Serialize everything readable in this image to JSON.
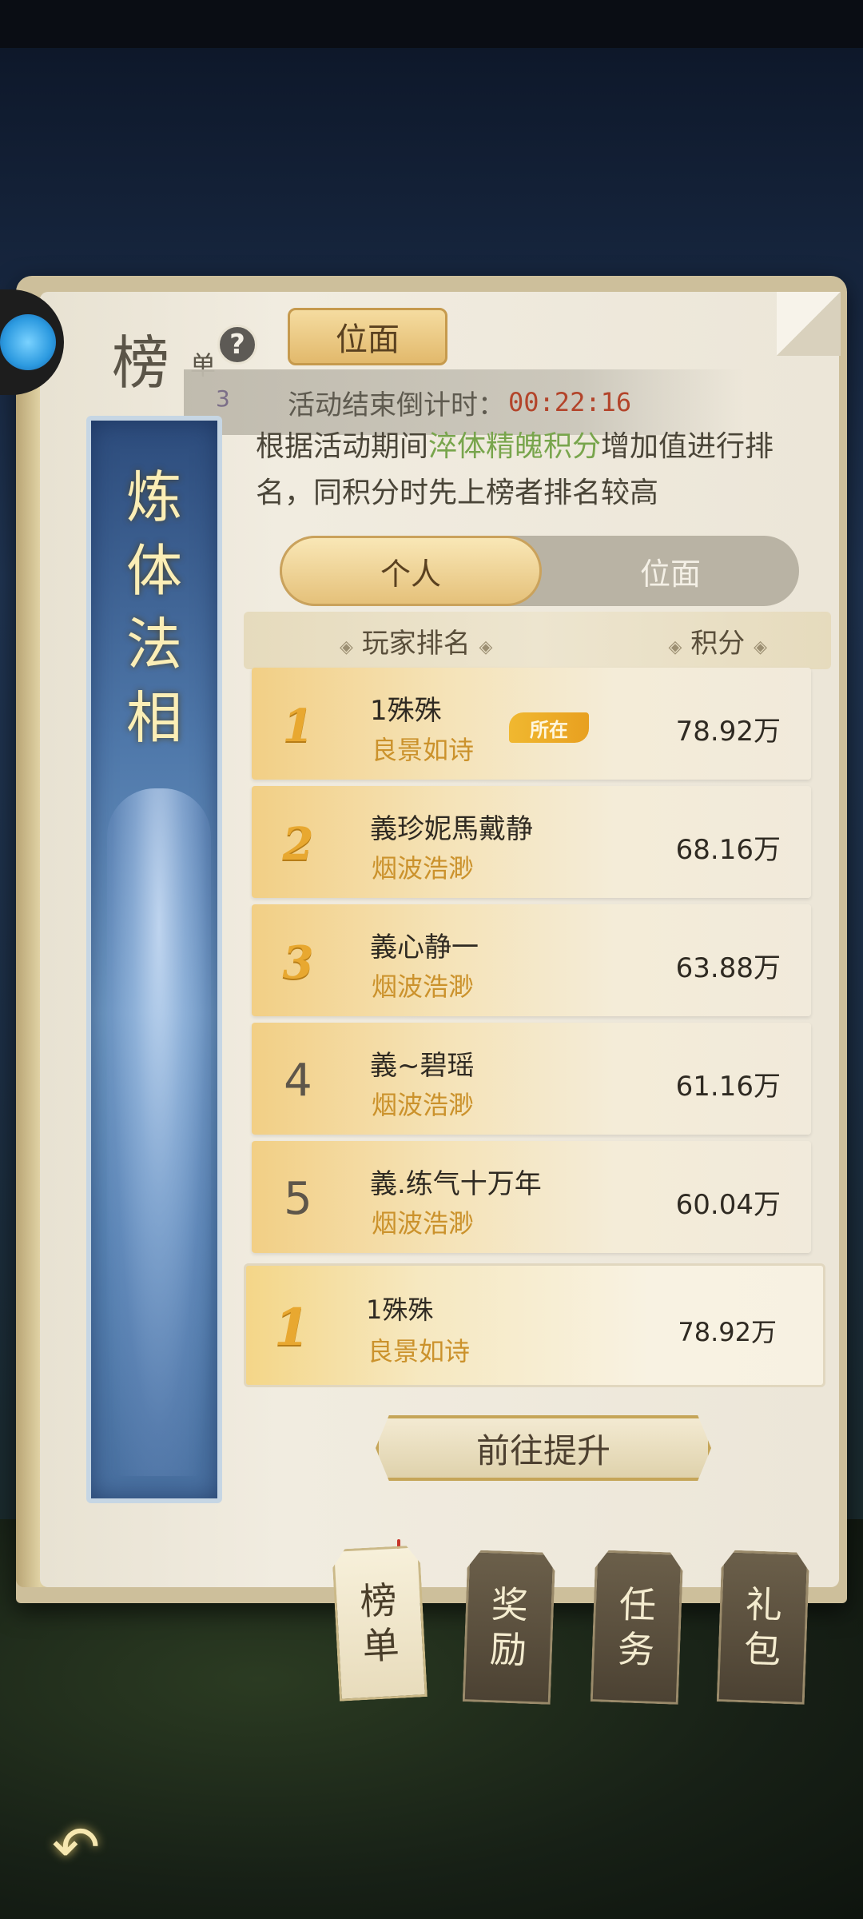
{
  "header": {
    "title_big": "榜",
    "title_small": "单",
    "help_label": "?",
    "plane_tab_label": "位面"
  },
  "countdown": {
    "label": "活动结束倒计时：",
    "time": "00:22:16",
    "hint": "3"
  },
  "banner": {
    "chars": [
      "炼",
      "体",
      "法",
      "相"
    ]
  },
  "description": {
    "prefix": "根据活动期间",
    "highlight": "淬体精魄积分",
    "suffix": "增加值进行排名，同积分时先上榜者排名较高"
  },
  "toggle": {
    "options": [
      {
        "label": "个人",
        "active": true
      },
      {
        "label": "位面",
        "active": false
      }
    ]
  },
  "table": {
    "col_name": "玩家排名",
    "col_score": "积分",
    "diamond": "◈",
    "rows": [
      {
        "rank": "1",
        "name": "1殊殊",
        "guild": "良景如诗",
        "score": "78.92万",
        "badge": "所在"
      },
      {
        "rank": "2",
        "name": "義珍妮馬戴静",
        "guild": "烟波浩渺",
        "score": "68.16万"
      },
      {
        "rank": "3",
        "name": "義心静一",
        "guild": "烟波浩渺",
        "score": "63.88万"
      },
      {
        "rank": "4",
        "name": "義~碧瑶",
        "guild": "烟波浩渺",
        "score": "61.16万"
      },
      {
        "rank": "5",
        "name": "義.练气十万年",
        "guild": "烟波浩渺",
        "score": "60.04万"
      }
    ]
  },
  "my_rank": {
    "rank": "1",
    "name": "1殊殊",
    "guild": "良景如诗",
    "score": "78.92万"
  },
  "improve_button": "前往提升",
  "tabs": [
    {
      "line1": "榜",
      "line2": "单",
      "active": true
    },
    {
      "line1": "奖",
      "line2": "励",
      "active": false
    },
    {
      "line1": "任",
      "line2": "务",
      "active": false
    },
    {
      "line1": "礼",
      "line2": "包",
      "active": false
    }
  ],
  "back_icon": "↶",
  "colors": {
    "accent_gold": "#e8a830",
    "guild_gold": "#cb922c",
    "highlight_green": "#78a54c",
    "countdown_red": "#b3442a"
  }
}
